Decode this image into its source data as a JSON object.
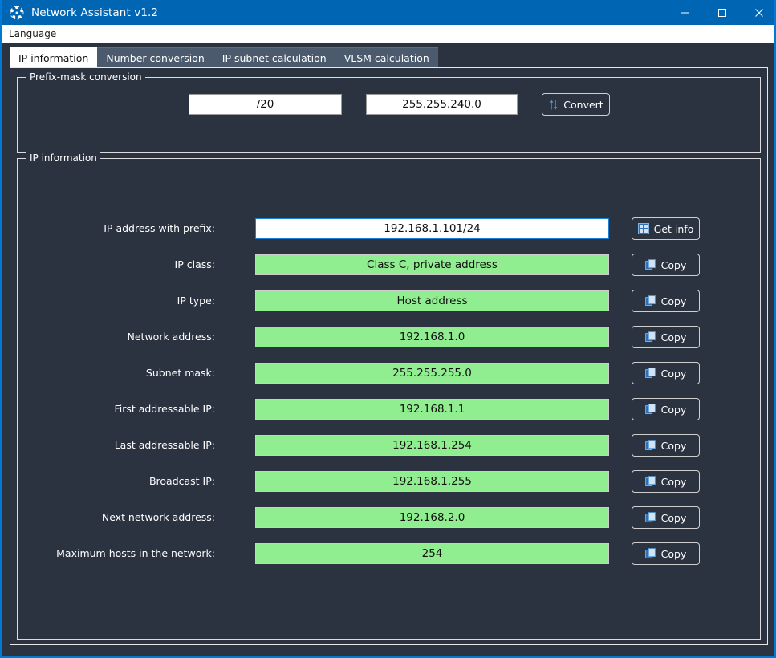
{
  "window": {
    "title": "Network Assistant v1.2",
    "icon": "network-nodes-icon",
    "controls": {
      "minimize": "minimize-icon",
      "maximize": "maximize-icon",
      "close": "close-icon"
    },
    "accent_color": "#0065b3",
    "body_color": "#2b3240"
  },
  "menubar": {
    "items": [
      {
        "label": "Language"
      }
    ]
  },
  "tabs": [
    {
      "label": "IP information",
      "active": true
    },
    {
      "label": "Number conversion",
      "active": false
    },
    {
      "label": "IP subnet calculation",
      "active": false
    },
    {
      "label": "VLSM calculation",
      "active": false
    }
  ],
  "prefix_mask_group": {
    "title": "Prefix-mask conversion",
    "prefix_input": {
      "value": "/20",
      "placeholder": ""
    },
    "mask_input": {
      "value": "255.255.240.0",
      "placeholder": ""
    },
    "convert_button": {
      "label": "Convert",
      "icon": "up-down-arrows-icon"
    }
  },
  "ip_information_group": {
    "title": "IP information",
    "value_color": "#90ee90",
    "rows": [
      {
        "label": "IP address with prefix:",
        "value": "192.168.1.101/24",
        "editable": true,
        "button": {
          "label": "Get info",
          "icon": "binary-grid-icon"
        }
      },
      {
        "label": "IP class:",
        "value": "Class C, private address",
        "editable": false,
        "button": {
          "label": "Copy",
          "icon": "copy-icon"
        }
      },
      {
        "label": "IP type:",
        "value": "Host address",
        "editable": false,
        "button": {
          "label": "Copy",
          "icon": "copy-icon"
        }
      },
      {
        "label": "Network address:",
        "value": "192.168.1.0",
        "editable": false,
        "button": {
          "label": "Copy",
          "icon": "copy-icon"
        }
      },
      {
        "label": "Subnet mask:",
        "value": "255.255.255.0",
        "editable": false,
        "button": {
          "label": "Copy",
          "icon": "copy-icon"
        }
      },
      {
        "label": "First addressable IP:",
        "value": "192.168.1.1",
        "editable": false,
        "button": {
          "label": "Copy",
          "icon": "copy-icon"
        }
      },
      {
        "label": "Last addressable IP:",
        "value": "192.168.1.254",
        "editable": false,
        "button": {
          "label": "Copy",
          "icon": "copy-icon"
        }
      },
      {
        "label": "Broadcast IP:",
        "value": "192.168.1.255",
        "editable": false,
        "button": {
          "label": "Copy",
          "icon": "copy-icon"
        }
      },
      {
        "label": "Next network address:",
        "value": "192.168.2.0",
        "editable": false,
        "button": {
          "label": "Copy",
          "icon": "copy-icon"
        }
      },
      {
        "label": "Maximum hosts in the network:",
        "value": "254",
        "editable": false,
        "button": {
          "label": "Copy",
          "icon": "copy-icon"
        }
      }
    ]
  }
}
